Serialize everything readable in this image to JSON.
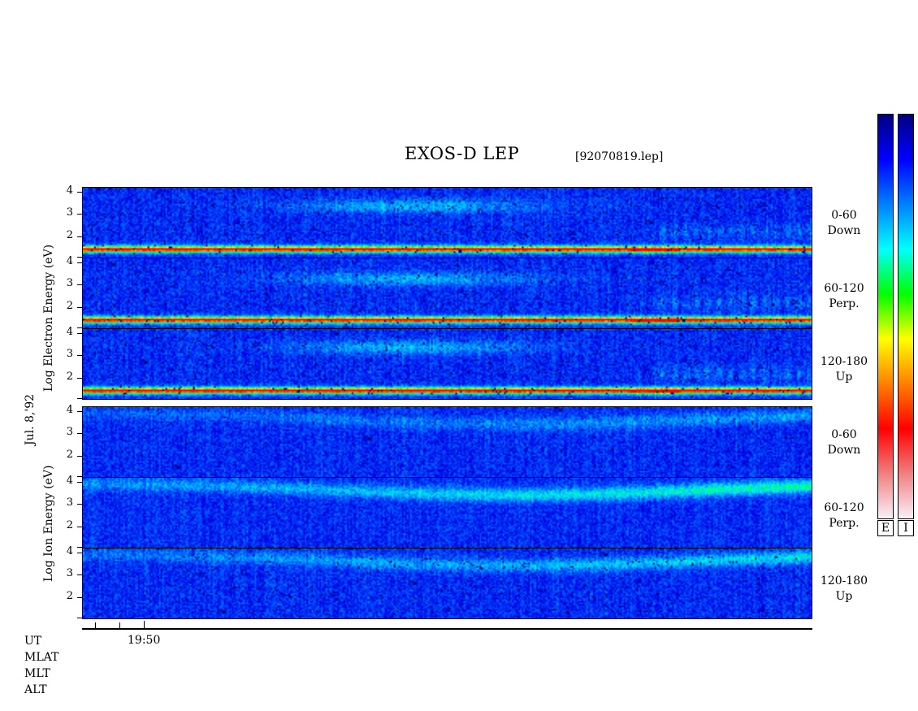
{
  "title": "EXOS-D LEP",
  "filename": "[92070819.lep]",
  "date_label": "Jul. 8,'92",
  "electron_ylabel": "Log Electron Energy (eV)",
  "ion_ylabel": "Log Ion Energy (eV)",
  "colorbar": {
    "electron_label": "E",
    "ion_label": "I"
  },
  "bottom_axis": {
    "rows": [
      "UT",
      "MLAT",
      "MLT",
      "ALT"
    ],
    "tick_label": "19:50"
  },
  "chart_data": {
    "type": "heatmap",
    "title": "EXOS-D LEP",
    "x_tick_labels": [
      "19:50"
    ],
    "y_tick_labels": [
      "2",
      "3",
      "4"
    ],
    "panels": [
      {
        "species": "Electron",
        "pitch_angle": "0-60",
        "direction": "Down",
        "ylim": [
          1,
          4.2
        ]
      },
      {
        "species": "Electron",
        "pitch_angle": "60-120",
        "direction": "Perp.",
        "ylim": [
          1,
          4.2
        ]
      },
      {
        "species": "Electron",
        "pitch_angle": "120-180",
        "direction": "Up",
        "ylim": [
          1,
          4.2
        ]
      },
      {
        "species": "Ion",
        "pitch_angle": "0-60",
        "direction": "Down",
        "ylim": [
          1,
          4.2
        ]
      },
      {
        "species": "Ion",
        "pitch_angle": "60-120",
        "direction": "Perp.",
        "ylim": [
          1,
          4.2
        ]
      },
      {
        "species": "Ion",
        "pitch_angle": "120-180",
        "direction": "Up",
        "ylim": [
          1,
          4.2
        ]
      }
    ],
    "colormap": [
      "#f8f0f8",
      "#f08080",
      "#ff0000",
      "#ff8000",
      "#ffff00",
      "#00ff00",
      "#00ffff",
      "#0080ff",
      "#0000ff",
      "#000080"
    ]
  }
}
